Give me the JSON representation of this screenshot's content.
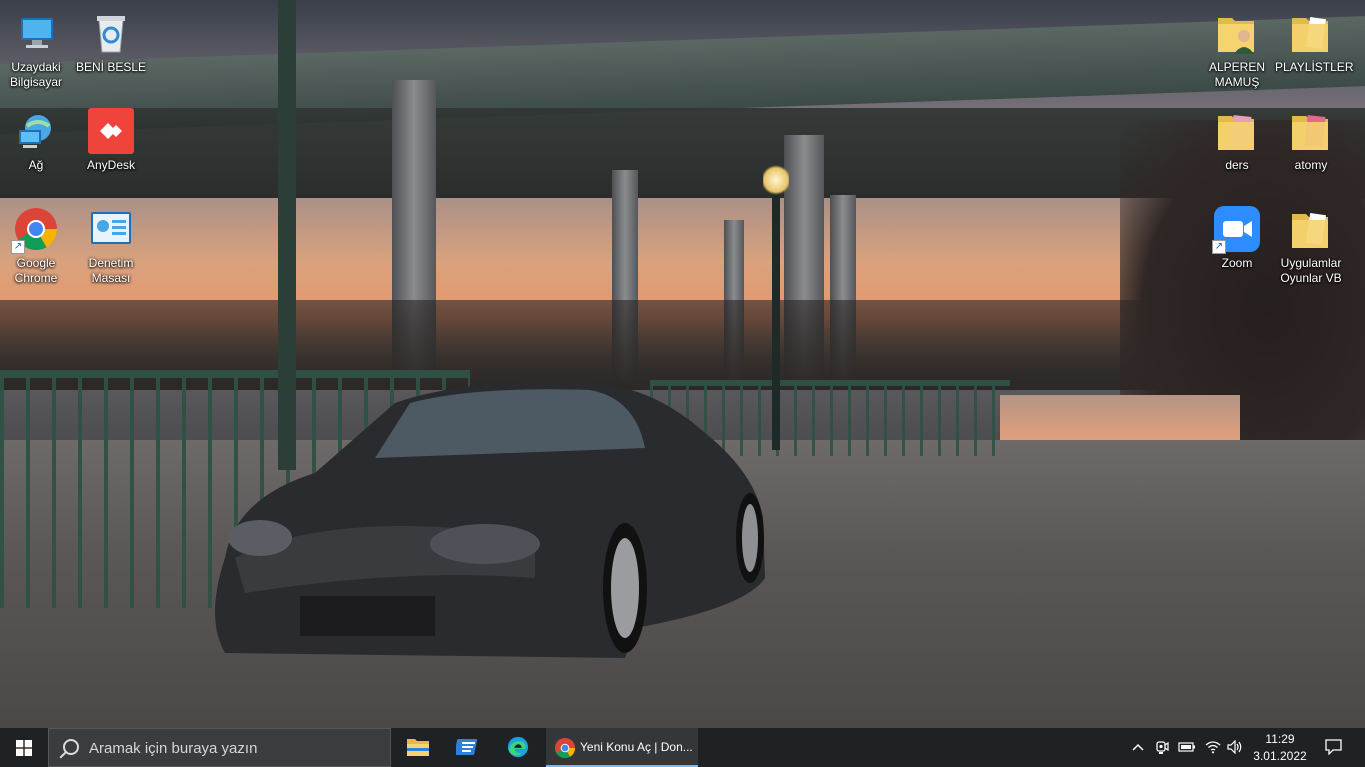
{
  "desktop": {
    "icons_left": [
      {
        "name": "uzaydaki-bilgisayar",
        "label": "Uzaydaki\nBilgisayar",
        "icon": "computer-icon"
      },
      {
        "name": "beni-besle",
        "label": "BENİ BESLE",
        "icon": "recycle-bin-icon"
      },
      {
        "name": "ag",
        "label": "Ağ",
        "icon": "network-icon"
      },
      {
        "name": "anydesk",
        "label": "AnyDesk",
        "icon": "anydesk-icon"
      },
      {
        "name": "google-chrome",
        "label": "Google\nChrome",
        "icon": "chrome-icon"
      },
      {
        "name": "denetim-masasi",
        "label": "Denetim\nMasası",
        "icon": "control-panel-icon"
      }
    ],
    "icons_right": [
      {
        "name": "alperen-mamus",
        "label": "ALPEREN\nMAMUŞ",
        "icon": "user-folder-icon"
      },
      {
        "name": "playlistler",
        "label": "PLAYLİSTLER",
        "icon": "folder-icon"
      },
      {
        "name": "ders",
        "label": "ders",
        "icon": "folder-icon"
      },
      {
        "name": "atomy",
        "label": "atomy",
        "icon": "folder-icon"
      },
      {
        "name": "zoom",
        "label": "Zoom",
        "icon": "zoom-icon"
      },
      {
        "name": "uygulamlar",
        "label": "Uygulamlar\nOyunlar VB",
        "icon": "folder-icon"
      }
    ]
  },
  "taskbar": {
    "search_placeholder": "Aramak için buraya yazın",
    "pinned": [
      {
        "name": "file-explorer",
        "icon": "folder-icon"
      },
      {
        "name": "control-panel",
        "icon": "control-panel-icon"
      },
      {
        "name": "edge",
        "icon": "edge-icon"
      }
    ],
    "active_app": {
      "title": "Yeni Konu Aç | Don...",
      "icon": "chrome-icon"
    },
    "time": "11:29",
    "date": "3.01.2022"
  },
  "colors": {
    "taskbar": "#1f2224",
    "search_box": "#3a3c3e",
    "active_underline": "#76b9ed"
  }
}
